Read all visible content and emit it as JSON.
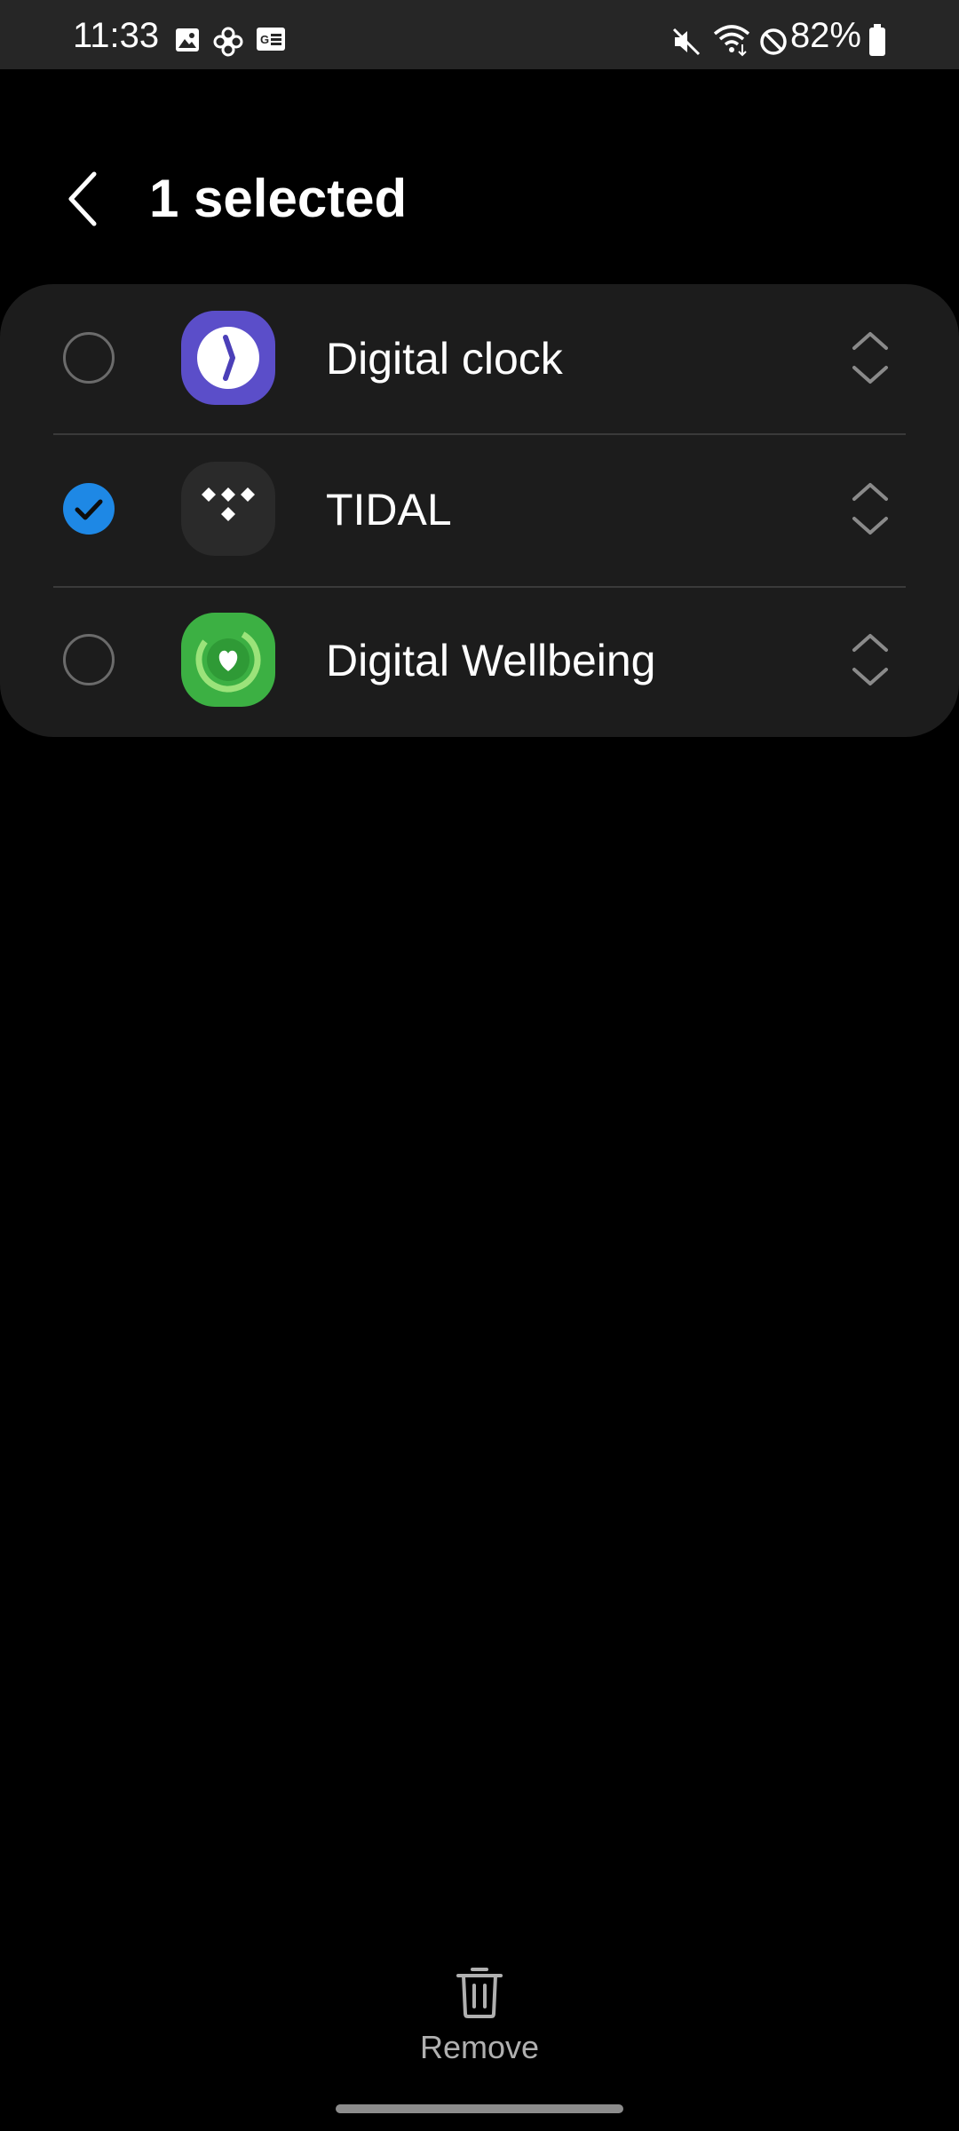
{
  "status_bar": {
    "time": "11:33",
    "battery_percent": "82%",
    "icons": [
      "gallery-icon",
      "pinwheel-icon",
      "news-icon",
      "mute-icon",
      "wifi-icon",
      "do-not-disturb-icon",
      "battery-icon"
    ]
  },
  "header": {
    "title": "1 selected",
    "back_icon": "chevron-left-icon"
  },
  "list": {
    "items": [
      {
        "label": "Digital clock",
        "selected": false,
        "icon": "digital-clock-app-icon"
      },
      {
        "label": "TIDAL",
        "selected": true,
        "icon": "tidal-app-icon"
      },
      {
        "label": "Digital Wellbeing",
        "selected": false,
        "icon": "digital-wellbeing-app-icon"
      }
    ]
  },
  "bottom_bar": {
    "remove_label": "Remove",
    "remove_icon": "trash-icon"
  },
  "colors": {
    "accent": "#1e88e5",
    "background": "#000000",
    "card": "#1c1c1c",
    "status_bar": "#262626"
  }
}
